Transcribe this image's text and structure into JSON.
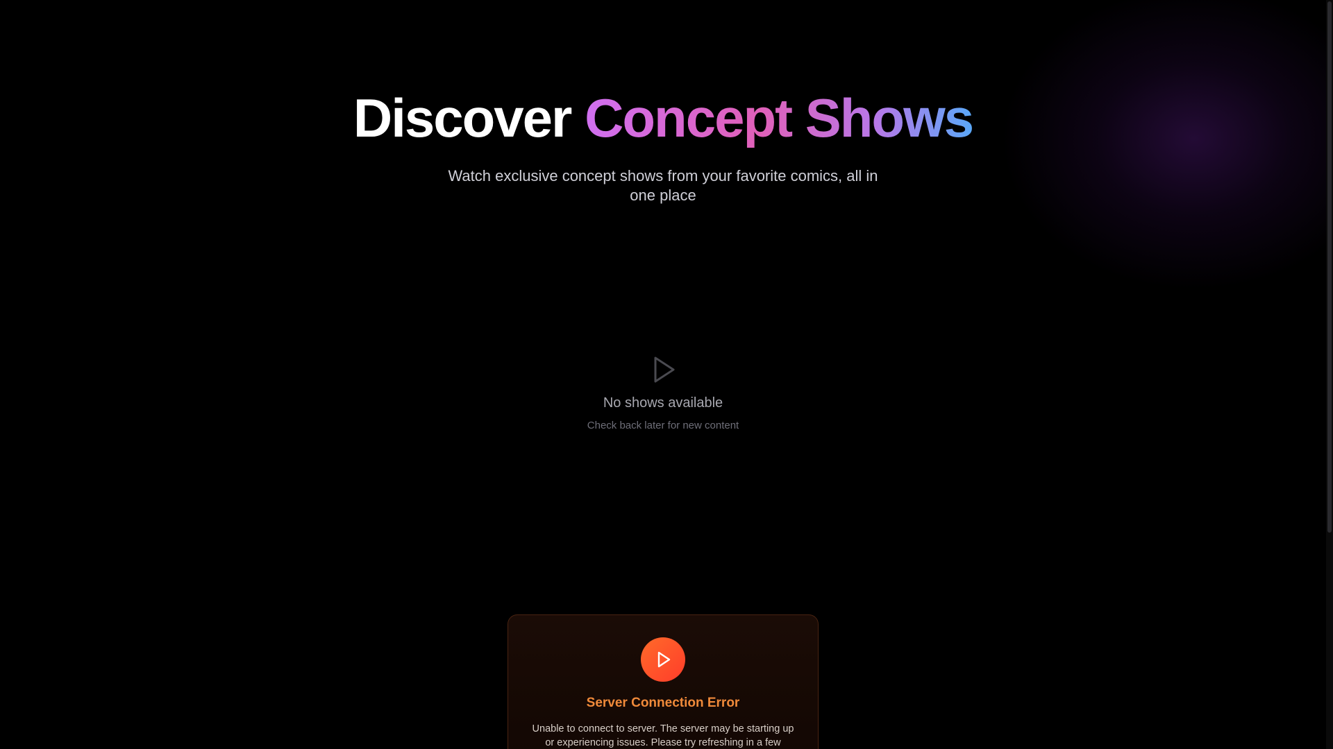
{
  "hero": {
    "title_plain": "Discover",
    "title_gradient": "Concept Shows",
    "subtitle": "Watch exclusive concept shows from your favorite comics, all in one place"
  },
  "empty_state": {
    "icon": "play-icon",
    "title": "No shows available",
    "subtitle": "Check back later for new content"
  },
  "error": {
    "icon": "play-icon",
    "title": "Server Connection Error",
    "message": "Unable to connect to server. The server may be starting up or experiencing issues. Please try refreshing in a few"
  },
  "colors": {
    "background": "#000000",
    "gradient_start": "#d070f0",
    "gradient_end": "#5aa8f8",
    "error_accent": "#f08a3a",
    "error_icon_bg": "#ff4a2a"
  }
}
